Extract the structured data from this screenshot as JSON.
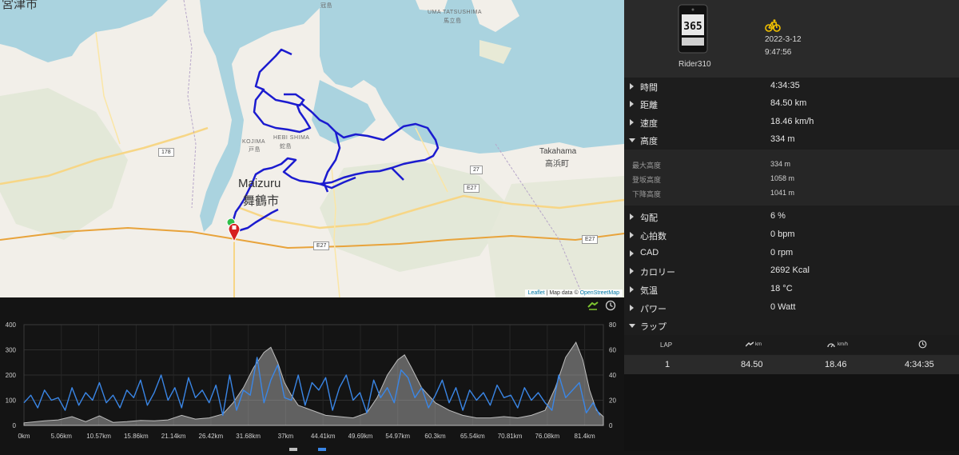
{
  "map": {
    "labels": {
      "miyazu": "宮津市",
      "maizuru_en": "Maizuru",
      "maizuru_jp": "舞鶴市",
      "kojima_en": "KOJIMA",
      "kojima_jp": "戸島",
      "hebi_en": "HEBI SHIMA",
      "hebi_jp": "蛇島",
      "uma_en": "UMA TATSUSHIMA",
      "uma_jp": "馬立島",
      "kanmuri": "冠島",
      "takahama_en": "Takahama",
      "takahama_jp": "高浜町"
    },
    "roads": [
      "178",
      "27",
      "E27",
      "E27",
      "E27"
    ],
    "attribution": {
      "leaflet": "Leaflet",
      "sep": " | Map data © ",
      "osm": "OpenStreetMap"
    }
  },
  "toolbar": {
    "bike_icon": "bike-speed-icon",
    "clock_icon": "clock-icon"
  },
  "device": {
    "name": "Rider310",
    "date": "2022-3-12",
    "time": "9:47:56",
    "screen_number": "365"
  },
  "stats": [
    {
      "label": "時間",
      "value": "4:34:35",
      "open": false
    },
    {
      "label": "距離",
      "value": "84.50 km",
      "open": false
    },
    {
      "label": "速度",
      "value": "18.46 km/h",
      "open": false
    },
    {
      "label": "高度",
      "value": "334 m",
      "open": true
    }
  ],
  "altitude_detail": [
    {
      "label": "最大高度",
      "value": "334 m"
    },
    {
      "label": "登坂高度",
      "value": "1058 m"
    },
    {
      "label": "下降高度",
      "value": "1041 m"
    }
  ],
  "stats2": [
    {
      "label": "勾配",
      "value": "6 %"
    },
    {
      "label": "心拍数",
      "value": "0 bpm"
    },
    {
      "label": "CAD",
      "value": "0 rpm"
    },
    {
      "label": "カロリー",
      "value": "2692 Kcal"
    },
    {
      "label": "気温",
      "value": "18 °C"
    },
    {
      "label": "パワー",
      "value": "0 Watt"
    }
  ],
  "laps_section": {
    "label": "ラップ"
  },
  "lap_table": {
    "headers": {
      "lap": "LAP",
      "km": "km",
      "kmh": "km/h"
    },
    "rows": [
      {
        "lap": "1",
        "distance": "84.50",
        "speed": "18.46",
        "time": "4:34:35"
      }
    ]
  },
  "chart_data": {
    "type": "line",
    "x_label_ticks": [
      "0km",
      "5.06km",
      "10.57km",
      "15.86km",
      "21.14km",
      "26.42km",
      "31.68km",
      "37km",
      "44.41km",
      "49.69km",
      "54.97km",
      "60.3km",
      "65.54km",
      "70.81km",
      "76.08km",
      "81.4km"
    ],
    "left_axis": {
      "ticks": [
        0,
        100,
        200,
        300,
        400
      ],
      "ylim": [
        0,
        400
      ]
    },
    "right_axis": {
      "ticks": [
        0,
        20,
        40,
        60,
        80
      ],
      "ylim": [
        0,
        80
      ]
    },
    "xlim": [
      0,
      84.5
    ],
    "series": [
      {
        "axis": "left",
        "kind": "area",
        "color": "#bdbdbd",
        "x": [
          0,
          3,
          5,
          7,
          9,
          11,
          13,
          15,
          17,
          19,
          21,
          23,
          25,
          27,
          29,
          30.5,
          32,
          33.5,
          35,
          36,
          37,
          38,
          39,
          40,
          42,
          44,
          46,
          48,
          50,
          51.5,
          53,
          54.5,
          55.5,
          56.5,
          58,
          60,
          62,
          64,
          66,
          68,
          70,
          72,
          74,
          76,
          77.5,
          79,
          80.5,
          81.5,
          82.5,
          83.5,
          84.5
        ],
        "y": [
          10,
          18,
          22,
          35,
          15,
          38,
          12,
          15,
          20,
          18,
          22,
          40,
          25,
          30,
          45,
          90,
          150,
          230,
          290,
          310,
          250,
          170,
          120,
          80,
          60,
          40,
          35,
          30,
          50,
          110,
          200,
          260,
          280,
          230,
          150,
          90,
          60,
          40,
          30,
          30,
          35,
          30,
          40,
          60,
          150,
          270,
          330,
          260,
          140,
          60,
          35
        ]
      },
      {
        "axis": "right",
        "kind": "line",
        "color": "#3a86e6",
        "x": [
          0,
          1,
          2,
          3,
          4,
          5,
          6,
          7,
          8,
          9,
          10,
          11,
          12,
          13,
          14,
          15,
          16,
          17,
          18,
          19,
          20,
          21,
          22,
          23,
          24,
          25,
          26,
          27,
          28,
          29,
          30,
          31,
          32,
          33,
          34,
          35,
          36,
          37,
          38,
          39,
          40,
          41,
          42,
          43,
          44,
          45,
          46,
          47,
          48,
          49,
          50,
          51,
          52,
          53,
          54,
          55,
          56,
          57,
          58,
          59,
          60,
          61,
          62,
          63,
          64,
          65,
          66,
          67,
          68,
          69,
          70,
          71,
          72,
          73,
          74,
          75,
          76,
          77,
          78,
          79,
          80,
          81,
          82,
          83,
          84
        ],
        "y": [
          18,
          24,
          14,
          28,
          20,
          22,
          12,
          30,
          16,
          26,
          20,
          34,
          18,
          24,
          14,
          28,
          22,
          36,
          16,
          26,
          40,
          20,
          30,
          14,
          38,
          22,
          28,
          18,
          32,
          8,
          40,
          12,
          28,
          24,
          54,
          18,
          36,
          48,
          22,
          20,
          40,
          16,
          34,
          28,
          38,
          12,
          30,
          40,
          20,
          26,
          10,
          36,
          22,
          30,
          18,
          44,
          38,
          22,
          30,
          14,
          24,
          36,
          18,
          30,
          12,
          28,
          20,
          26,
          16,
          32,
          22,
          24,
          14,
          30,
          20,
          26,
          18,
          12,
          40,
          22,
          28,
          34,
          10,
          18,
          8
        ]
      }
    ]
  }
}
